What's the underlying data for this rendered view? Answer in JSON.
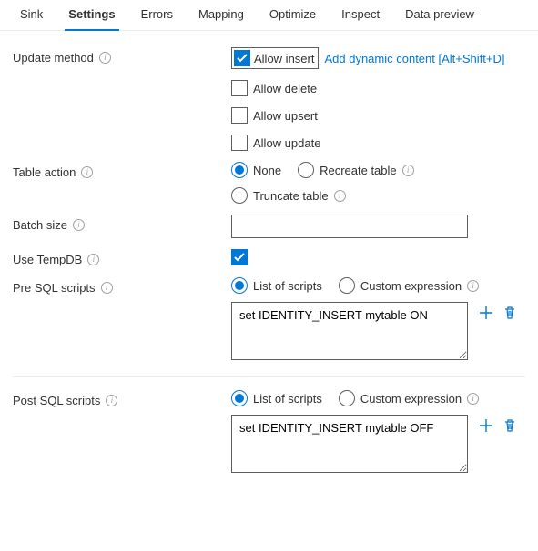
{
  "tabs": {
    "sink": "Sink",
    "settings": "Settings",
    "errors": "Errors",
    "mapping": "Mapping",
    "optimize": "Optimize",
    "inspect": "Inspect",
    "data_preview": "Data preview"
  },
  "update_method": {
    "label": "Update method",
    "allow_insert": "Allow insert",
    "allow_delete": "Allow delete",
    "allow_upsert": "Allow upsert",
    "allow_update": "Allow update",
    "dynamic_content_link": "Add dynamic content [Alt+Shift+D]"
  },
  "table_action": {
    "label": "Table action",
    "none": "None",
    "recreate": "Recreate table",
    "truncate": "Truncate table"
  },
  "batch_size": {
    "label": "Batch size",
    "value": ""
  },
  "use_tempdb": {
    "label": "Use TempDB"
  },
  "pre_sql": {
    "label": "Pre SQL scripts",
    "list_of_scripts": "List of scripts",
    "custom_expression": "Custom expression",
    "value": "set IDENTITY_INSERT mytable ON"
  },
  "post_sql": {
    "label": "Post SQL scripts",
    "list_of_scripts": "List of scripts",
    "custom_expression": "Custom expression",
    "value": "set IDENTITY_INSERT mytable OFF"
  }
}
